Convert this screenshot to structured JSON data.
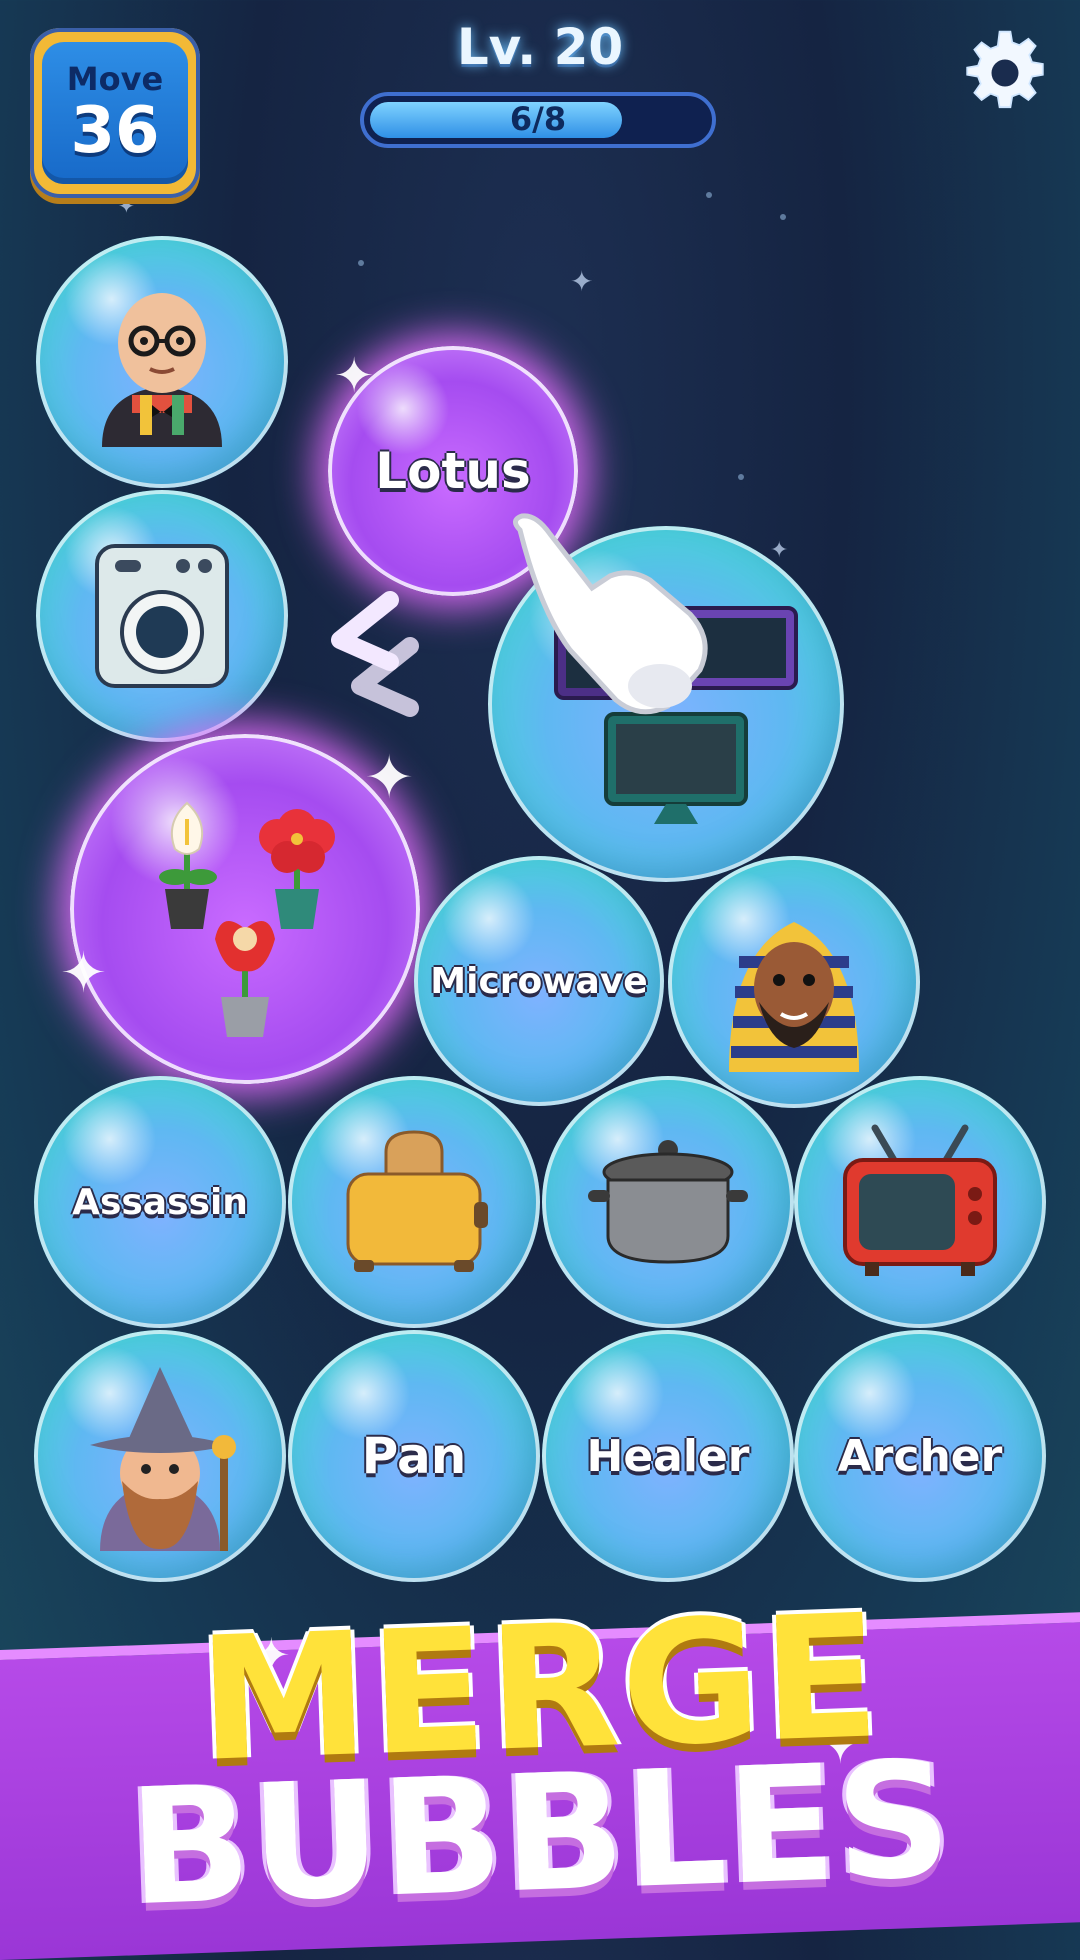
{
  "hud": {
    "move_label": "Move",
    "move_count": "36",
    "level": "Lv. 20",
    "progress_text": "6/8",
    "progress_value": 0.75,
    "settings_icon": "gear-icon"
  },
  "bubbles": {
    "professor": {
      "icon": "bald-professor-icon"
    },
    "lotus": {
      "label": "Lotus"
    },
    "washing_machine": {
      "icon": "washing-machine-icon"
    },
    "tvs": {
      "icon": "monitors-icon"
    },
    "flowers": {
      "icon": "potted-flowers-icon"
    },
    "microwave": {
      "label": "Microwave"
    },
    "pharaoh": {
      "icon": "pharaoh-icon"
    },
    "assassin": {
      "label": "Assassin"
    },
    "toaster": {
      "icon": "toaster-icon"
    },
    "pot": {
      "icon": "cooking-pot-icon"
    },
    "tv": {
      "icon": "retro-tv-icon"
    },
    "wizard": {
      "icon": "wizard-icon"
    },
    "pan": {
      "label": "Pan"
    },
    "healer": {
      "label": "Healer"
    },
    "archer": {
      "label": "Archer"
    }
  },
  "banner": {
    "line1": "MERGE",
    "line2": "BUBBLES"
  },
  "colors": {
    "accent_yellow": "#ffe23a",
    "banner_purple": "#b64ae8",
    "bubble_blue": "#5fb8f2",
    "glow_purple": "#c96bff"
  }
}
